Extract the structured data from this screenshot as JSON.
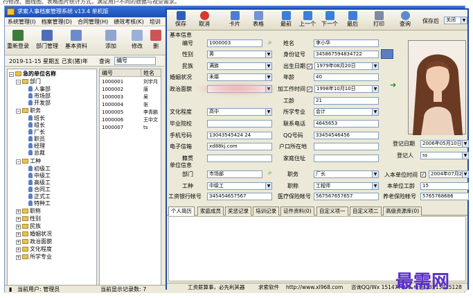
{
  "top_caption": "行修改、曲线图、表格图片统计方式，满足用户不同的数据与视觉需求。",
  "window": {
    "title": "求索人事档案管理系统 v13.4 单机版"
  },
  "menu": [
    "系统管理(I)",
    "档案管理(D)",
    "合同管理(H)",
    "绩效考核(K)",
    "培训"
  ],
  "toolbar": [
    "重新登录",
    "部门管理",
    "基本资料",
    "添加",
    "修改",
    "删"
  ],
  "info": {
    "date": "2019-11-15 星期五 己亥(猪)年",
    "query_label": "查询",
    "query_value": "编号"
  },
  "tree": {
    "root": "急的单位名称",
    "groups": [
      {
        "label": "部门",
        "children": [
          "人事部",
          "市场部",
          "开发部"
        ]
      },
      {
        "label": "职务",
        "children": [
          "班长",
          "组长",
          "厂长",
          "职员",
          "经理",
          "总裁"
        ]
      },
      {
        "label": "工种",
        "children": [
          "初级工",
          "中级工",
          "高级工",
          "合同工",
          "正式工",
          "特种工"
        ]
      }
    ],
    "closed": [
      "职称",
      "性别",
      "民族",
      "婚姻状况",
      "政治面貌",
      "文化程度",
      "所学专业"
    ]
  },
  "grid": {
    "headers": [
      "编号",
      "姓名"
    ],
    "rows": [
      [
        "1000001",
        "刘宇月"
      ],
      [
        "1000002",
        "唐"
      ],
      [
        "1000003",
        "吴"
      ],
      [
        "1000004",
        "张"
      ],
      [
        "1000005",
        "李青鹏"
      ],
      [
        "1000006",
        "王中文"
      ],
      [
        "1000007",
        "ts"
      ]
    ]
  },
  "status": {
    "user": "当前用户: 管理员",
    "count": "当前显示记录数: 7"
  },
  "dialog": {
    "toolbar": [
      "保存",
      "取消",
      "卡片",
      "表格",
      "最前",
      "上一个",
      "下一个",
      "最后",
      "打印",
      "查询"
    ],
    "save_after_label": "保存后",
    "save_after_value": "关闭",
    "basic_title": "基本信息",
    "fields": {
      "bianhao": {
        "label": "编号",
        "value": "1000003"
      },
      "xingbie": {
        "label": "性别",
        "value": "男"
      },
      "minzu": {
        "label": "民族",
        "value": "满族"
      },
      "hunyin": {
        "label": "婚姻状况",
        "value": "未婚"
      },
      "zhengzhi": {
        "label": "政治面貌",
        "value": ""
      },
      "wenhua": {
        "label": "文化程度",
        "value": "高中"
      },
      "xuexiao": {
        "label": "毕业院校",
        "value": ""
      },
      "shouji": {
        "label": "手机号码",
        "value": "13043545424 24"
      },
      "email": {
        "label": "电子信箱",
        "value": "xd88kj.com"
      },
      "jiguan": {
        "label": "籍贯",
        "value": ""
      },
      "xingming": {
        "label": "姓名",
        "value": "李小华"
      },
      "sfz": {
        "label": "身份证号",
        "value": "345867594834722"
      },
      "chusheng": {
        "label": "出生日期",
        "value": "1979年08月20日"
      },
      "nianling": {
        "label": "年龄",
        "value": "40"
      },
      "jiagong": {
        "label": "加工作时间",
        "value": "1998年10月10日"
      },
      "gongling": {
        "label": "工龄",
        "value": "21"
      },
      "zhuanye": {
        "label": "所学专业",
        "value": "会计"
      },
      "dianhua": {
        "label": "联系电话",
        "value": "4645653"
      },
      "qq": {
        "label": "QQ号码",
        "value": "33454546456"
      },
      "hukou": {
        "label": "户口所在地",
        "value": ""
      },
      "zhuzhi": {
        "label": "家庭住址",
        "value": ""
      },
      "dengji_rq": {
        "label": "登记日期",
        "value": "2006年05月10日"
      },
      "dengji_ren": {
        "label": "登记人",
        "value": "ss"
      }
    },
    "unit_title": "单位信息",
    "unit": {
      "bumen": {
        "label": "部门",
        "value": "市场部"
      },
      "gongzhong": {
        "label": "工种",
        "value": "中级工"
      },
      "gongzi": {
        "label": "工资银行帐号",
        "value": "345454657567"
      },
      "zhiwu": {
        "label": "职务",
        "value": "厂长"
      },
      "zhicheng": {
        "label": "职称",
        "value": "工程师"
      },
      "yiliao": {
        "label": "医疗保险帐号",
        "value": "567567657657"
      },
      "rudan": {
        "label": "入本单位时间",
        "value": "2004年07月29日"
      },
      "bendan": {
        "label": "本单位工龄",
        "value": "15"
      },
      "yanglao": {
        "label": "养老保险帐号",
        "value": "5765768686"
      }
    },
    "tabs": [
      "个人简历",
      "家庭成员",
      "奖惩记录",
      "培训记录",
      "证件资料(0)",
      "自定义项一",
      "自定义项二",
      "高级资源库(0)"
    ],
    "footer": [
      "工资薪算事，必先利其器",
      "求索软件",
      "http://www.xl968.com",
      "咨询QQ/Wx 151477039",
      "电话 13513025128"
    ]
  },
  "watermark": "最需网"
}
